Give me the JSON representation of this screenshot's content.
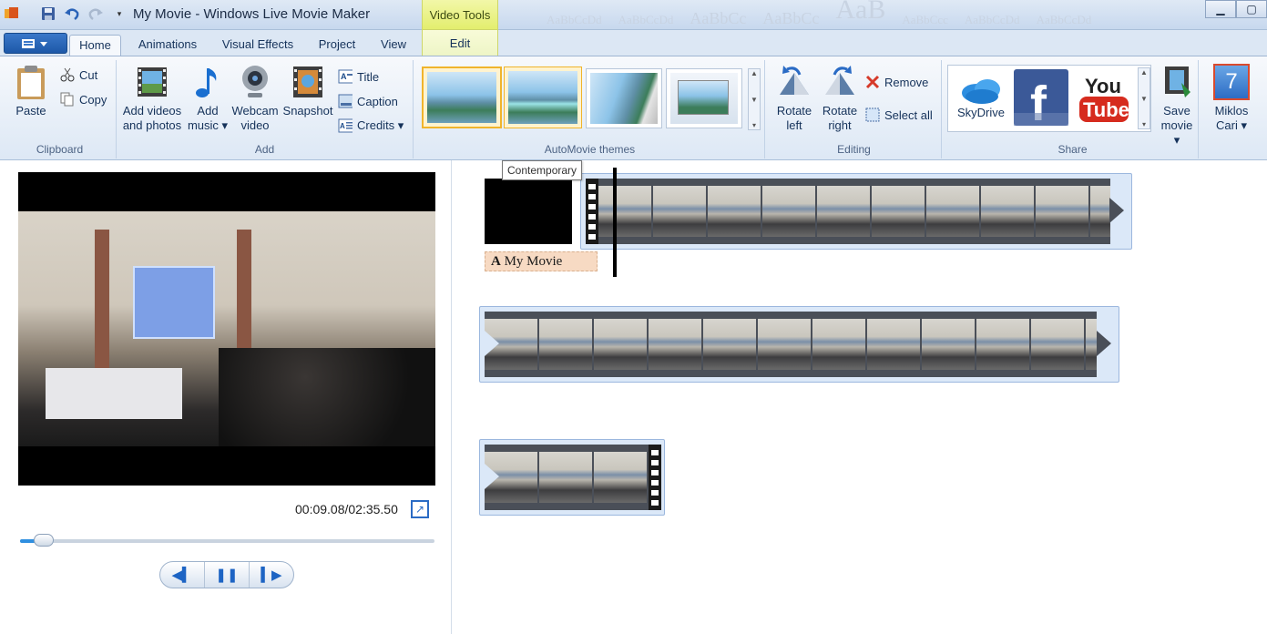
{
  "window": {
    "title": "My Movie - Windows Live Movie Maker",
    "context_tab_group": "Video Tools",
    "font_gallery": [
      "AaBbCcDd",
      "AaBbCcDd",
      "AaBbCc",
      "AaBbCc",
      "AaB",
      "AaBbCcc",
      "AaBbCcDd",
      "AaBbCcDd"
    ]
  },
  "tabs": [
    {
      "label": "Home",
      "active": true
    },
    {
      "label": "Animations"
    },
    {
      "label": "Visual Effects"
    },
    {
      "label": "Project"
    },
    {
      "label": "View"
    },
    {
      "label": "Edit",
      "context": true
    }
  ],
  "ribbon": {
    "clipboard": {
      "label": "Clipboard",
      "paste": "Paste",
      "cut": "Cut",
      "copy": "Copy"
    },
    "add": {
      "label": "Add",
      "add_videos": [
        "Add videos",
        "and photos"
      ],
      "add_music": [
        "Add",
        "music ▾"
      ],
      "webcam": [
        "Webcam",
        "video"
      ],
      "snapshot": "Snapshot",
      "title": "Title",
      "caption": "Caption",
      "credits": "Credits ▾"
    },
    "themes": {
      "label": "AutoMovie themes"
    },
    "editing": {
      "label": "Editing",
      "rotate_left": [
        "Rotate",
        "left"
      ],
      "rotate_right": [
        "Rotate",
        "right"
      ],
      "remove": "Remove",
      "select_all": "Select all"
    },
    "share": {
      "label": "Share",
      "skydrive": "SkyDrive",
      "save_movie": [
        "Save",
        "movie ▾"
      ],
      "user": [
        "Miklos",
        "Cari ▾"
      ],
      "user_tile_number": "7"
    }
  },
  "tooltip": "Contemporary",
  "preview": {
    "timecode": "00:09.08/02:35.50",
    "progress": 0.058
  },
  "storyboard": {
    "caption": "My Movie"
  },
  "colors": {
    "accent": "#2f8fe0",
    "context_tab": "#e3ee6e",
    "selected_theme": "#f0b42c"
  }
}
